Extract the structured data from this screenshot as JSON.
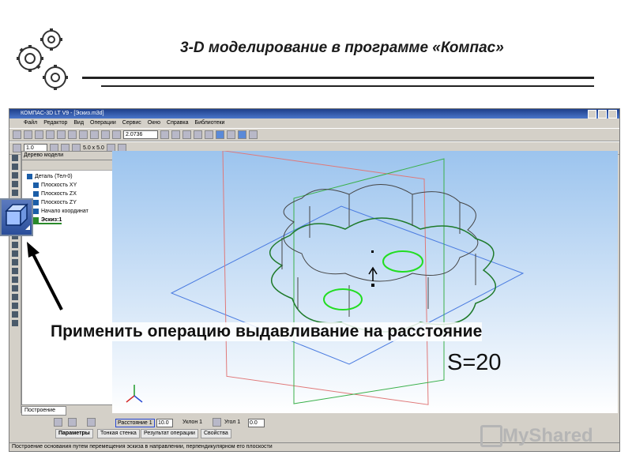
{
  "slide": {
    "title": "3-D моделирование в программе «Компас»",
    "caption": "Применить операцию выдавливание на расстояние",
    "s_value": "S=20",
    "watermark": "MyShared"
  },
  "app": {
    "window_title": "КОМПАС-3D LT V9 - [Эскиз.m3d]",
    "menu": [
      "Файл",
      "Редактор",
      "Вид",
      "Операции",
      "Сервис",
      "Окно",
      "Справка",
      "Библиотеки"
    ],
    "zoom_value": "2.0736",
    "line_width": "1.0",
    "grid_step": "5.0 x 5.0",
    "tree": {
      "title": "Дерево модели",
      "items": [
        "Деталь (Тел-0)",
        "Плоскость XY",
        "Плоскость ZX",
        "Плоскость ZY",
        "Начало координат",
        "Эскиз:1"
      ],
      "tab": "Построение"
    },
    "properties": {
      "distance_label": "Расстояние 1",
      "distance_value": "10.0",
      "angle_label": "Уклон 1",
      "angle2_label": "Угол 1",
      "angle_value": "0.0",
      "tabs": [
        "Параметры",
        "Тонкая стенка",
        "Результат операции",
        "Свойства"
      ]
    },
    "status": "Построение основания путем перемещения эскиза в направлении, перпендикулярном его плоскости"
  },
  "colors": {
    "title_bar": "#1e3f8a",
    "sketch_green": "#22dd22",
    "plane_blue": "#4a7be0",
    "plane_red": "#e07878"
  }
}
